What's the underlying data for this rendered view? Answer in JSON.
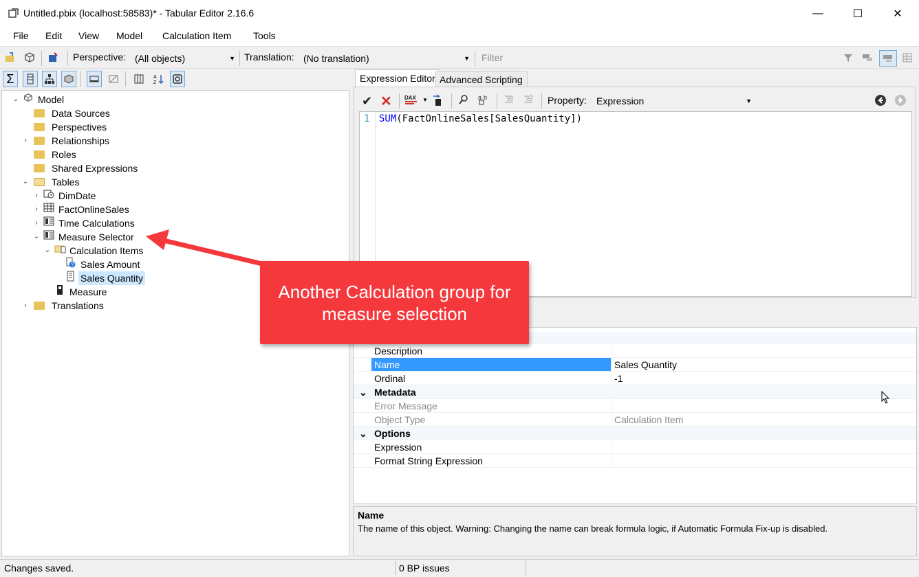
{
  "window": {
    "title": "Untitled.pbix (localhost:58583)* - Tabular Editor 2.16.6",
    "minimize_glyph": "—",
    "maximize_glyph": "☐",
    "close_glyph": "✕"
  },
  "menu": [
    "File",
    "Edit",
    "View",
    "Model",
    "Calculation Item",
    "Tools"
  ],
  "toolbar": {
    "perspective_label": "Perspective:",
    "perspective_value": "(All objects)",
    "translation_label": "Translation:",
    "translation_value": "(No translation)",
    "filter_placeholder": "Filter"
  },
  "tree": {
    "model": "Model",
    "data_sources": "Data Sources",
    "perspectives": "Perspectives",
    "relationships": "Relationships",
    "roles": "Roles",
    "shared_expressions": "Shared Expressions",
    "tables": "Tables",
    "dimdate": "DimDate",
    "factonlinesales": "FactOnlineSales",
    "time_calculations": "Time Calculations",
    "measure_selector": "Measure Selector",
    "calculation_items": "Calculation Items",
    "sales_amount": "Sales Amount",
    "sales_quantity": "Sales Quantity",
    "measure": "Measure",
    "translations": "Translations"
  },
  "editor": {
    "tab_expression": "Expression Editor",
    "tab_scripting": "Advanced Scripting",
    "property_label": "Property:",
    "property_value": "Expression",
    "line_number": "1",
    "code_fn": "SUM",
    "code_rest": "(FactOnlineSales[SalesQuantity])"
  },
  "properties": {
    "description": "Description",
    "name": "Name",
    "name_value": "Sales Quantity",
    "ordinal": "Ordinal",
    "ordinal_value": "-1",
    "metadata": "Metadata",
    "error_message": "Error Message",
    "object_type": "Object Type",
    "object_type_value": "Calculation Item",
    "options": "Options",
    "expression": "Expression",
    "format_string_expression": "Format String Expression"
  },
  "description_panel": {
    "title": "Name",
    "text": "The name of this object. Warning: Changing the name can break formula logic, if Automatic Formula Fix-up is disabled."
  },
  "status": {
    "left": "Changes saved.",
    "middle": "0 BP issues"
  },
  "callout": {
    "line1": "Another Calculation group for",
    "line2": "measure selection"
  },
  "colors": {
    "callout": "#f5383c",
    "selection": "#3399ff",
    "selection_soft": "#cce8ff",
    "code_blue": "#0000ff"
  }
}
